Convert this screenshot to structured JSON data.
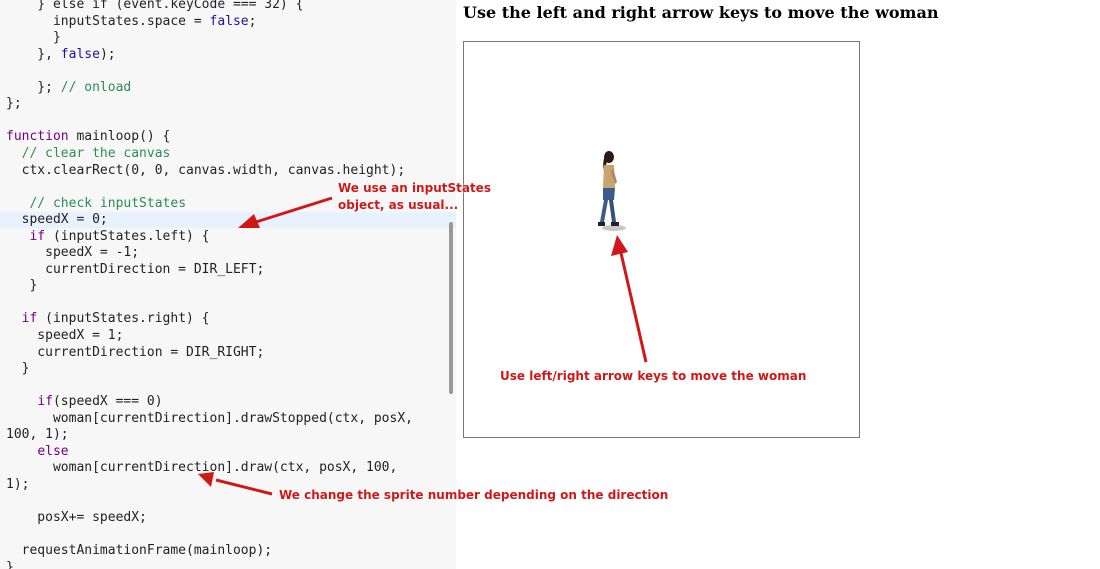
{
  "editor": {
    "lines": [
      {
        "segments": [
          {
            "t": "    } else if (event.keyCode === 32) {"
          }
        ]
      },
      {
        "segments": [
          {
            "t": "      inputStates.space = "
          },
          {
            "t": "false",
            "c": "tk-bool"
          },
          {
            "t": ";"
          }
        ]
      },
      {
        "segments": [
          {
            "t": "      }"
          }
        ]
      },
      {
        "segments": [
          {
            "t": "    }, "
          },
          {
            "t": "false",
            "c": "tk-bool"
          },
          {
            "t": ");"
          }
        ]
      },
      {
        "segments": [
          {
            "t": ""
          }
        ]
      },
      {
        "segments": [
          {
            "t": "    }; "
          },
          {
            "t": "// onload",
            "c": "tk-cm2"
          }
        ]
      },
      {
        "segments": [
          {
            "t": "};"
          }
        ]
      },
      {
        "segments": [
          {
            "t": ""
          }
        ]
      },
      {
        "segments": [
          {
            "t": "function",
            "c": "tk-kw"
          },
          {
            "t": " mainloop() {"
          }
        ]
      },
      {
        "segments": [
          {
            "t": "  "
          },
          {
            "t": "// clear the canvas",
            "c": "tk-cm2"
          }
        ]
      },
      {
        "segments": [
          {
            "t": "  ctx.clearRect(0, 0, canvas.width, canvas.height);"
          }
        ]
      },
      {
        "segments": [
          {
            "t": ""
          }
        ]
      },
      {
        "segments": [
          {
            "t": "   "
          },
          {
            "t": "// check inputStates",
            "c": "tk-cm2"
          }
        ]
      },
      {
        "segments": [
          {
            "t": "  speedX = 0;"
          }
        ],
        "highlight": true
      },
      {
        "segments": [
          {
            "t": "   "
          },
          {
            "t": "if",
            "c": "tk-kw"
          },
          {
            "t": " (inputStates.left) {"
          }
        ]
      },
      {
        "segments": [
          {
            "t": "     speedX = -1;"
          }
        ]
      },
      {
        "segments": [
          {
            "t": "     currentDirection = DIR_LEFT;"
          }
        ]
      },
      {
        "segments": [
          {
            "t": "   }"
          }
        ]
      },
      {
        "segments": [
          {
            "t": ""
          }
        ]
      },
      {
        "segments": [
          {
            "t": "  "
          },
          {
            "t": "if",
            "c": "tk-kw"
          },
          {
            "t": " (inputStates.right) {"
          }
        ]
      },
      {
        "segments": [
          {
            "t": "    speedX = 1;"
          }
        ]
      },
      {
        "segments": [
          {
            "t": "    currentDirection = DIR_RIGHT;"
          }
        ]
      },
      {
        "segments": [
          {
            "t": "  }"
          }
        ]
      },
      {
        "segments": [
          {
            "t": ""
          }
        ]
      },
      {
        "segments": [
          {
            "t": "    "
          },
          {
            "t": "if",
            "c": "tk-kw"
          },
          {
            "t": "(speedX === 0)"
          }
        ]
      },
      {
        "segments": [
          {
            "t": "      woman[currentDirection].drawStopped(ctx, posX,"
          }
        ]
      },
      {
        "segments": [
          {
            "t": "100, 1);"
          }
        ]
      },
      {
        "segments": [
          {
            "t": "    "
          },
          {
            "t": "else",
            "c": "tk-kw"
          }
        ]
      },
      {
        "segments": [
          {
            "t": "      woman[currentDirection].draw(ctx, posX, 100,"
          }
        ]
      },
      {
        "segments": [
          {
            "t": "1);"
          }
        ]
      },
      {
        "segments": [
          {
            "t": ""
          }
        ]
      },
      {
        "segments": [
          {
            "t": "    posX+= speedX;"
          }
        ]
      },
      {
        "segments": [
          {
            "t": ""
          }
        ]
      },
      {
        "segments": [
          {
            "t": "  requestAnimationFrame(mainloop);"
          }
        ]
      },
      {
        "segments": [
          {
            "t": "}"
          }
        ]
      }
    ]
  },
  "demo": {
    "title": "Use the left and right arrow keys to move the woman"
  },
  "annotations": {
    "input_states_line1": "We use an inputStates",
    "input_states_line2": "object, as usual...",
    "canvas_note": "Use left/right arrow keys to move the woman",
    "sprite_note": "We change the sprite number depending on the direction"
  },
  "colors": {
    "annotation": "#d01818",
    "editor_bg": "#f7f7f7",
    "keyword": "#770088",
    "comment": "#2e8b57",
    "boolean": "#221199"
  },
  "icons": [
    "sprite-woman-icon",
    "annotation-arrow-icon"
  ]
}
